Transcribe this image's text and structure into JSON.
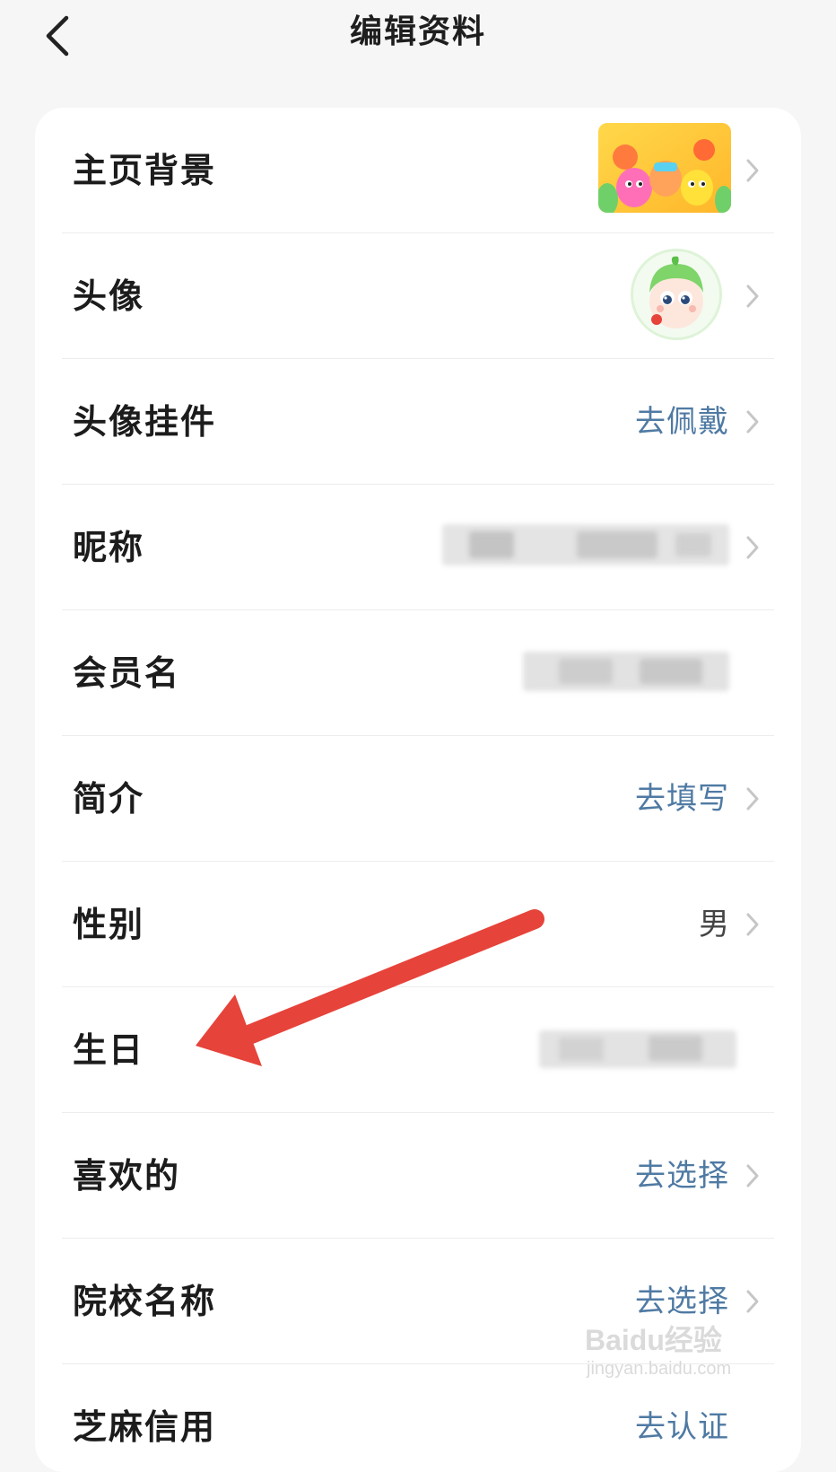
{
  "header": {
    "title": "编辑资料"
  },
  "rows": [
    {
      "label": "主页背景",
      "value": "",
      "type": "image-bg"
    },
    {
      "label": "头像",
      "value": "",
      "type": "image-avatar"
    },
    {
      "label": "头像挂件",
      "value": "去佩戴",
      "type": "link"
    },
    {
      "label": "昵称",
      "value": "",
      "type": "blurred"
    },
    {
      "label": "会员名",
      "value": "",
      "type": "blurred"
    },
    {
      "label": "简介",
      "value": "去填写",
      "type": "link"
    },
    {
      "label": "性别",
      "value": "男",
      "type": "plain"
    },
    {
      "label": "生日",
      "value": "",
      "type": "blurred"
    },
    {
      "label": "喜欢的",
      "value": "去选择",
      "type": "link"
    },
    {
      "label": "院校名称",
      "value": "去选择",
      "type": "link"
    },
    {
      "label": "芝麻信用",
      "value": "去认证",
      "type": "link"
    }
  ],
  "annotation": {
    "arrow_color": "#e6433a"
  },
  "watermark": {
    "brand": "Baidu经验",
    "url": "jingyan.baidu.com"
  },
  "colors": {
    "link": "#4f7aa3",
    "background": "#f6f6f6",
    "card": "#ffffff"
  }
}
